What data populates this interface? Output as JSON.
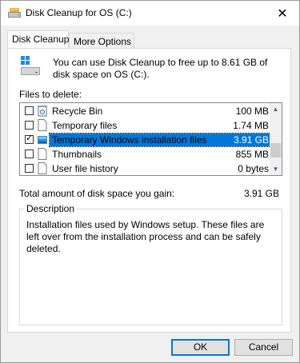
{
  "window": {
    "title": "Disk Cleanup for OS (C:)",
    "close_glyph": "✕"
  },
  "tabs": [
    {
      "label": "Disk Cleanup",
      "active": true
    },
    {
      "label": "More Options",
      "active": false
    }
  ],
  "intro_text": "You can use Disk Cleanup to free up to 8.61 GB of disk space on OS (C:).",
  "files_label": "Files to delete:",
  "files": [
    {
      "name": "Recycle Bin",
      "size": "100 MB",
      "checked": false,
      "selected": false,
      "icon": "recycle-bin-icon"
    },
    {
      "name": "Temporary files",
      "size": "1.74 MB",
      "checked": false,
      "selected": false,
      "icon": "file-icon"
    },
    {
      "name": "Temporary Windows installation files",
      "size": "3.91 GB",
      "checked": true,
      "selected": true,
      "icon": "windows-setup-icon"
    },
    {
      "name": "Thumbnails",
      "size": "855 MB",
      "checked": false,
      "selected": false,
      "icon": "file-icon"
    },
    {
      "name": "User file history",
      "size": "0 bytes",
      "checked": false,
      "selected": false,
      "icon": "file-icon"
    }
  ],
  "total": {
    "label": "Total amount of disk space you gain:",
    "value": "3.91 GB"
  },
  "description": {
    "legend": "Description",
    "text": "Installation files used by Windows setup.  These files are left over from the installation process and can be safely deleted."
  },
  "buttons": {
    "ok": "OK",
    "cancel": "Cancel"
  },
  "colors": {
    "selection": "#0078d7",
    "ok_border": "#0078d7"
  }
}
